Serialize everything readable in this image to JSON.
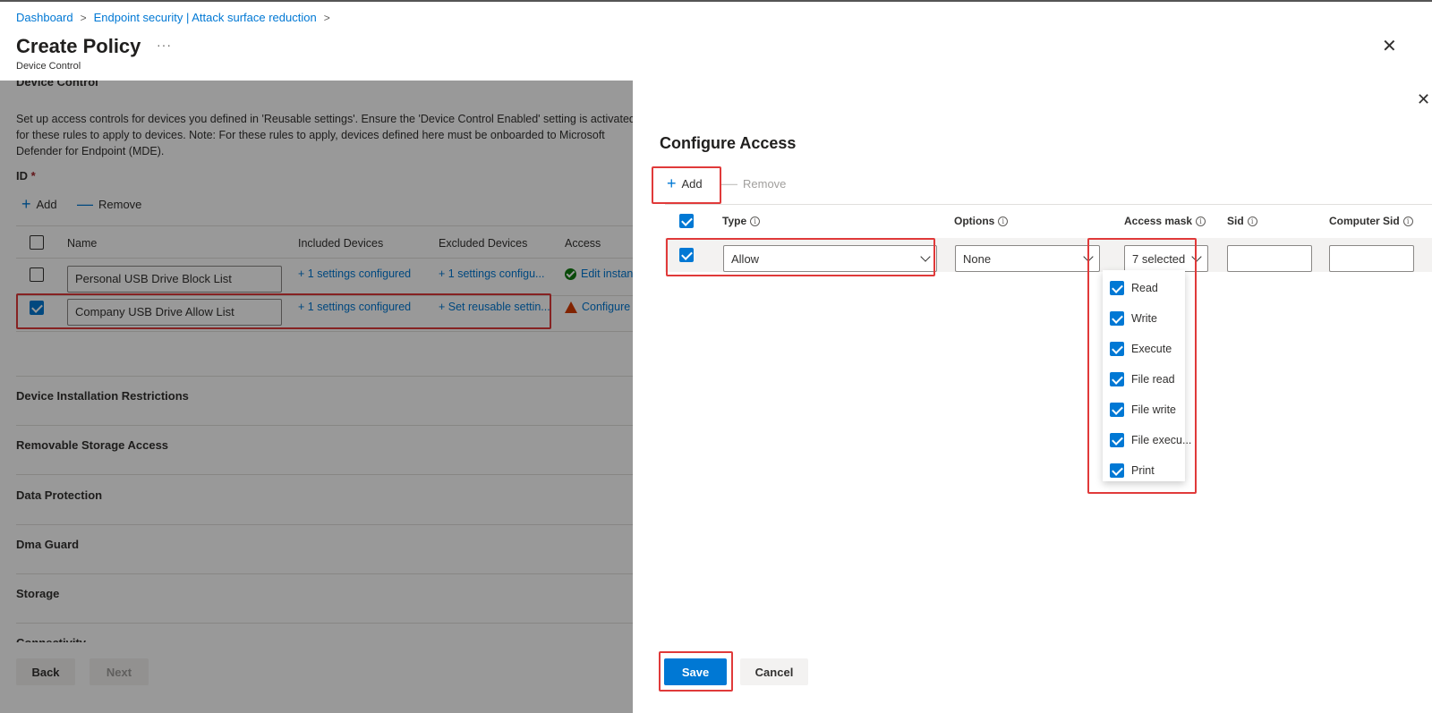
{
  "breadcrumb": [
    {
      "label": "Dashboard"
    },
    {
      "label": "Endpoint security | Attack surface reduction"
    }
  ],
  "header": {
    "title": "Create Policy",
    "more": "···",
    "subtitle": "Device Control",
    "close_icon": "close-icon"
  },
  "left": {
    "section_cut": "Device Control",
    "description": "Set up access controls for devices you defined in 'Reusable settings'. Ensure the 'Device Control Enabled' setting is activated for these rules to apply to devices. Note: For these rules to apply, devices defined here must be onboarded to Microsoft Defender for Endpoint (MDE).",
    "id_label": "ID",
    "required_mark": "*",
    "add_label": "Add",
    "remove_label": "Remove",
    "columns": [
      "Name",
      "Included Devices",
      "Excluded Devices",
      "Access"
    ],
    "rows": [
      {
        "checked": false,
        "name": "Personal USB Drive Block List",
        "included": "+ 1 settings configured",
        "excluded": "+ 1 settings configu...",
        "access": "Edit instance",
        "access_status": "ok"
      },
      {
        "checked": true,
        "name": "Company USB Drive Allow List",
        "included": "+ 1 settings configured",
        "excluded": "+ Set reusable settin...",
        "access": "Configure ins",
        "access_status": "warning"
      }
    ],
    "sections": [
      "Device Installation Restrictions",
      "Removable Storage Access",
      "Data Protection",
      "Dma Guard",
      "Storage",
      "Connectivity"
    ],
    "back_label": "Back",
    "next_label": "Next"
  },
  "panel": {
    "title": "Configure Access",
    "add_label": "Add",
    "remove_label": "Remove",
    "columns": [
      "Type",
      "Options",
      "Access mask",
      "Sid",
      "Computer Sid"
    ],
    "row": {
      "checked": true,
      "type_value": "Allow",
      "options_value": "None",
      "access_mask_value": "7 selected",
      "sid_value": "",
      "computer_sid_value": ""
    },
    "access_mask_options": [
      {
        "label": "Read",
        "checked": true
      },
      {
        "label": "Write",
        "checked": true
      },
      {
        "label": "Execute",
        "checked": true
      },
      {
        "label": "File read",
        "checked": true
      },
      {
        "label": "File write",
        "checked": true
      },
      {
        "label": "File execu...",
        "checked": true
      },
      {
        "label": "Print",
        "checked": true
      }
    ],
    "save_label": "Save",
    "cancel_label": "Cancel"
  },
  "colors": {
    "accent": "#0078d4",
    "highlight": "#e03a3a",
    "warning": "#d83b01",
    "success": "#107c10"
  }
}
